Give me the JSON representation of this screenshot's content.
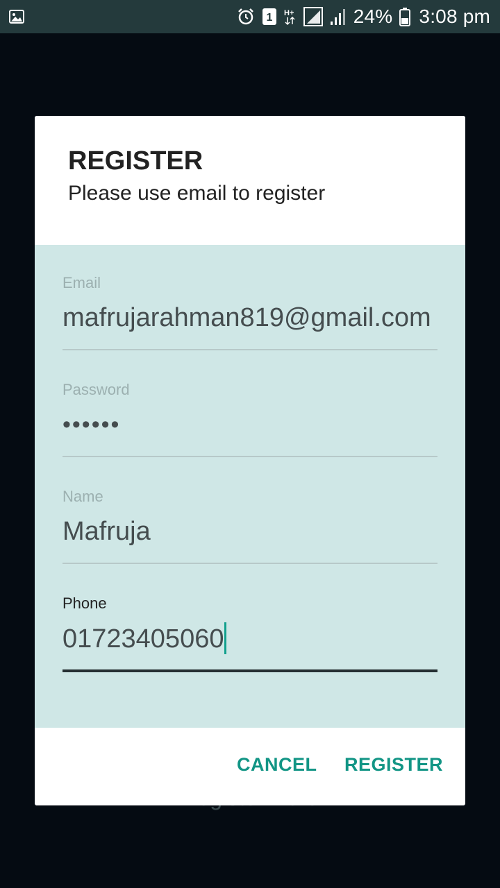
{
  "status_bar": {
    "icons": [
      "gallery-icon",
      "alarm-icon",
      "sim-1-icon",
      "hplus-data-icon",
      "signal-icon",
      "signal-weak-icon",
      "battery-icon"
    ],
    "sim_number": "1",
    "network_type": "H+",
    "battery_percent": "24%",
    "time": "3:08 pm"
  },
  "background": {
    "hint_text": "Register Here"
  },
  "dialog": {
    "title": "REGISTER",
    "subtitle": "Please use email to register",
    "fields": {
      "email": {
        "label": "Email",
        "value": "mafrujarahman819@gmail.com"
      },
      "password": {
        "label": "Password",
        "value": "••••••"
      },
      "name": {
        "label": "Name",
        "value": "Mafruja"
      },
      "phone": {
        "label": "Phone",
        "value": "01723405060"
      }
    },
    "actions": {
      "cancel": "CANCEL",
      "register": "REGISTER"
    }
  },
  "colors": {
    "status_bar": "#243a3c",
    "form_background": "#cfe7e6",
    "accent": "#129585",
    "backdrop": "#050b12"
  }
}
